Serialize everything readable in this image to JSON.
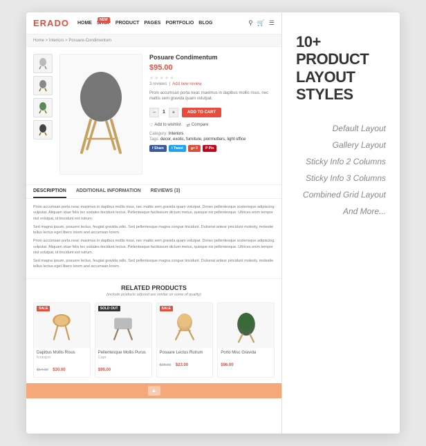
{
  "brand": {
    "name_part1": "ERA",
    "name_part2": "D",
    "name_part3": "O"
  },
  "navbar": {
    "links": [
      "HOME",
      "SHOP",
      "PRODUCT",
      "PAGES",
      "PORTFOLIO",
      "BLOG"
    ],
    "shop_badge": "NEW"
  },
  "breadcrumb": {
    "text": "Home > Interiors > Posuare-Condimentum"
  },
  "product": {
    "title": "Posuare Condimentum",
    "price": "$95.00",
    "reviews_count": "3 reviews",
    "add_review": "Add new review",
    "description": "Proin accumsan porta neac maximus in dapibus mollis risus, nec mattis sem gravida quam volutpat.",
    "quantity": "1",
    "add_to_cart": "ADD TO CART",
    "wishlist": "Add to wishlist",
    "compare": "Compare",
    "category": "Interiors",
    "tags": "decor, exotic, furniture, porrmutters, light office"
  },
  "tabs": {
    "items": [
      "DESCRIPTION",
      "ADDITIONAL INFORMATION",
      "REVIEWS (3)"
    ]
  },
  "desc_paragraphs": [
    "Proin accumsan porta neac maximus in dapibus mollis risus, nec mattis sem gravida quam volutpat. Donec pellentesque scelerisque adipiscing vulputat. Aliquam vitae felis tec sodales tincidunt lectus. Pellentesque facilisisum dictum metus, quisque nix pellentesque. Ultrices enim tempor nisl volutpat, id tincidunt est rutrum.",
    "Sed magna ipsum, posuere lectus, feugiat gravida odio. Sed pellentesque magna congue tincidunt. Dulserat, antesr pincidunt molesty, molestie tellus lectus eget libero lorem and accumsan lorem.",
    "Proin accumsan porta neac maximus in dapibus mollis risus, nec mattis sem gravida quam volutpat. Donec pellentesque scelerisque adipiscing vulputat. Aliquam vitae felis tec sodales tincidunt lectus. Pellentesque facilisisum dictum metus, quisque nix pellentesque. Ultrices enim tempor nisl volutpat, id tincidunt est rutrum.",
    "Sed magna ipsum, posuere lectus, feugiat gravida odio. Sed pellentesque magna congue tincidunt. Dulserat, antesr pincidunt molesty, molestie tellus lectus eget libero lorem and accumsan lorem."
  ],
  "related": {
    "title": "RELATED PRODUCTS",
    "subtitle": "(include products adjured are similar on some of quality)",
    "products": [
      {
        "name": "Dapibus Mollis Risus",
        "color": "funksjon",
        "old_price": "$54.00",
        "price": "$30.00",
        "badge": "SALE",
        "badge_type": "sale"
      },
      {
        "name": "Pellentesque Mollis Purus",
        "color": "Capr",
        "old_price": "",
        "price": "$99.00",
        "badge": "SOLD OUT",
        "badge_type": "sold"
      },
      {
        "name": "Posuare Lectus Rutrum",
        "color": "",
        "old_price": "$28.00",
        "price": "$23.00",
        "badge": "SALE",
        "badge_type": "sale"
      },
      {
        "name": "Porto Misc Gravida",
        "color": "",
        "old_price": "",
        "price": "$96.00",
        "badge": "",
        "badge_type": ""
      }
    ]
  },
  "right_heading": "10+ PRODUCT LAYOUT STYLES",
  "layout_styles": [
    "Default Layout",
    "Gallery Layout",
    "Sticky Info 2 Columns",
    "Sticky Info 3 Columns",
    "Combined Grid Layout",
    "And More..."
  ]
}
